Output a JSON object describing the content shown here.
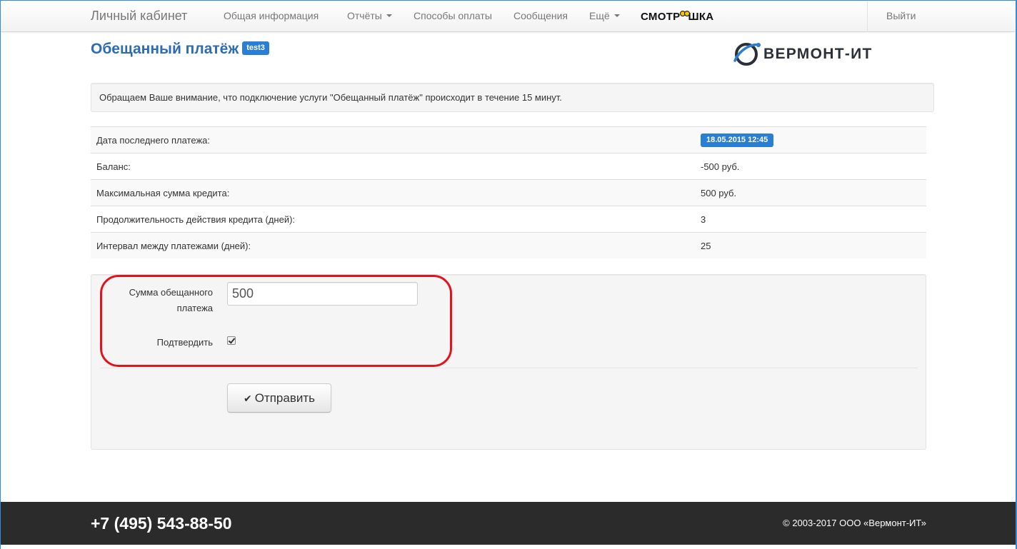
{
  "navbar": {
    "brand": "Личный кабинет",
    "items": [
      {
        "label": "Общая информация"
      },
      {
        "label": "Отчёты"
      },
      {
        "label": "Способы оплаты"
      },
      {
        "label": "Сообщения"
      },
      {
        "label": "Ещё"
      }
    ],
    "partner_logo": {
      "prefix": "СМОТР",
      "suffix": "ШКА"
    },
    "logout": "Выйти"
  },
  "header": {
    "title": "Обещанный платёж",
    "user_badge": "test3",
    "company_logo": "ВЕРМОНТ-ИТ"
  },
  "notice": "Обращаем Ваше внимание, что подключение услуги \"Обещанный платёж\" происходит в течение 15 минут.",
  "details": [
    {
      "label": "Дата последнего платежа:",
      "value": "18.05.2015 12:45"
    },
    {
      "label": "Баланс:",
      "value": "-500 руб."
    },
    {
      "label": "Максимальная сумма кредита:",
      "value": "500 руб."
    },
    {
      "label": "Продолжительность действия кредита (дней):",
      "value": "3"
    },
    {
      "label": "Интервал между платежами (дней):",
      "value": "25"
    }
  ],
  "form": {
    "amount_label_line1": "Сумма обещанного",
    "amount_label_line2": "платежа",
    "amount_value": "500",
    "confirm_label": "Подтвердить",
    "confirm_checked": true,
    "submit_label": "Отправить"
  },
  "footer": {
    "phone": "+7 (495) 543-88-50",
    "copyright": "© 2003-2017 ООО «Вермонт-ИТ»"
  },
  "colors": {
    "accent": "#2b6cb5",
    "badge": "#2a7ed3",
    "highlight": "#e3131d",
    "footer_bg": "#2b2b2b"
  }
}
